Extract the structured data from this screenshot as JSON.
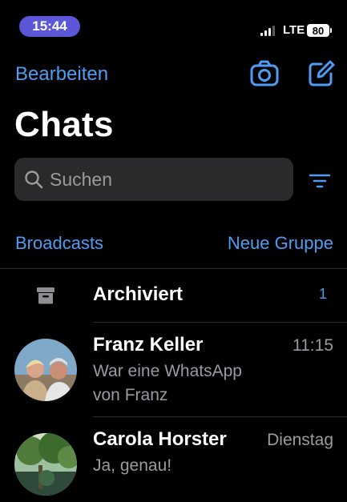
{
  "status_bar": {
    "time": "15:44",
    "network": "LTE",
    "battery": "80"
  },
  "header": {
    "edit_label": "Bearbeiten",
    "title": "Chats"
  },
  "search": {
    "placeholder": "Suchen"
  },
  "actions": {
    "broadcasts": "Broadcasts",
    "new_group": "Neue Gruppe"
  },
  "archive": {
    "label": "Archiviert",
    "count": "1"
  },
  "chats": [
    {
      "name": "Franz Keller",
      "time": "11:15",
      "message_line1": "War eine WhatsApp",
      "message_line2": "von Franz"
    },
    {
      "name": "Carola Horster",
      "time": "Dienstag",
      "message_line1": "Ja, genau!"
    }
  ],
  "colors": {
    "accent": "#4f9df2",
    "time_pill": "#5b57d6",
    "background": "#000000",
    "search_bg": "#2a2a2c"
  }
}
